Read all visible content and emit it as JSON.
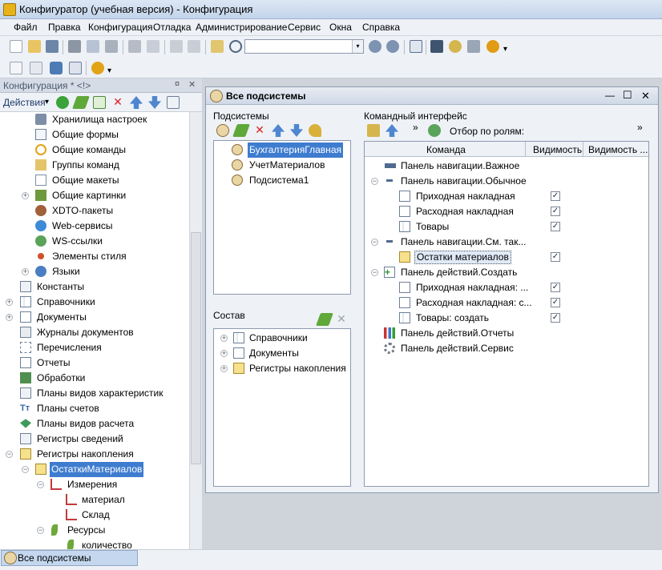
{
  "window": {
    "title": "Конфигуратор (учебная версия) - Конфигурация"
  },
  "menu": [
    "Файл",
    "Правка",
    "Конфигурация",
    "Отладка",
    "Администрирование",
    "Сервис",
    "Окна",
    "Справка"
  ],
  "left_panel": {
    "title": "Конфигурация * <!>",
    "actions_label": "Действия",
    "tree": [
      {
        "label": "Хранилища настроек"
      },
      {
        "label": "Общие формы"
      },
      {
        "label": "Общие команды"
      },
      {
        "label": "Группы команд"
      },
      {
        "label": "Общие макеты"
      },
      {
        "label": "Общие картинки"
      },
      {
        "label": "XDTO-пакеты"
      },
      {
        "label": "Web-сервисы"
      },
      {
        "label": "WS-ссылки"
      },
      {
        "label": "Элементы стиля"
      },
      {
        "label": "Языки"
      },
      {
        "label": "Константы"
      },
      {
        "label": "Справочники"
      },
      {
        "label": "Документы"
      },
      {
        "label": "Журналы документов"
      },
      {
        "label": "Перечисления"
      },
      {
        "label": "Отчеты"
      },
      {
        "label": "Обработки"
      },
      {
        "label": "Планы видов характеристик"
      },
      {
        "label": "Планы счетов"
      },
      {
        "label": "Планы видов расчета"
      },
      {
        "label": "Регистры сведений"
      },
      {
        "label": "Регистры накопления"
      },
      {
        "label": "ОстаткиМатериалов"
      },
      {
        "label": "Измерения"
      },
      {
        "label": "материал"
      },
      {
        "label": "Склад"
      },
      {
        "label": "Ресурсы"
      },
      {
        "label": "количество"
      }
    ]
  },
  "subsystems_window": {
    "title": "Все подсистемы",
    "subsystems_label": "Подсистемы",
    "subsystems": [
      "БухгалтерияГлавная",
      "УчетМатериалов",
      "Подсистема1"
    ],
    "composition_label": "Состав",
    "composition": [
      "Справочники",
      "Документы",
      "Регистры накопления"
    ],
    "command_interface_label": "Командный интерфейс",
    "filter_label": "Отбор по ролям:",
    "columns": [
      "Команда",
      "Видимость",
      "Видимость ..."
    ],
    "rows": [
      {
        "label": "Панель навигации.Важное"
      },
      {
        "label": "Панель навигации.Обычное"
      },
      {
        "label": "Приходная накладная",
        "checked": "✓"
      },
      {
        "label": "Расходная накладная",
        "checked": "✓"
      },
      {
        "label": "Товары",
        "checked": "✓"
      },
      {
        "label": "Панель навигации.См. так..."
      },
      {
        "label": "Остатки материалов",
        "checked": "✓"
      },
      {
        "label": "Панель действий.Создать"
      },
      {
        "label": "Приходная накладная: ...",
        "checked": "✓"
      },
      {
        "label": "Расходная накладная: с...",
        "checked": "✓"
      },
      {
        "label": "Товары: создать",
        "checked": "✓"
      },
      {
        "label": "Панель действий.Отчеты"
      },
      {
        "label": "Панель действий.Сервис"
      }
    ]
  },
  "taskbar": {
    "tab": "Все подсистемы"
  },
  "window_controls": {
    "min": "—",
    "max": "☐",
    "close": "✕",
    "panel_pin": "¤",
    "panel_close": "✕",
    "plus": "+",
    "minus": "−",
    "dropdown": "▾",
    "more": "»"
  }
}
